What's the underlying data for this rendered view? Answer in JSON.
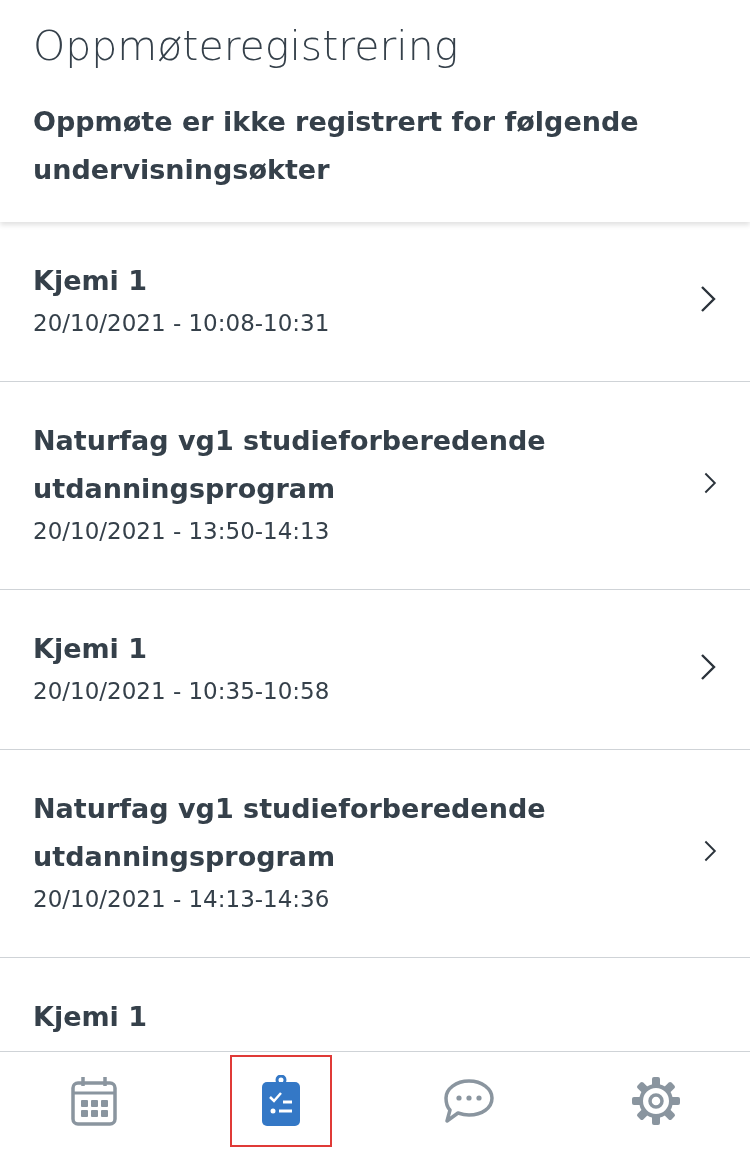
{
  "header": {
    "title": "Oppmøteregistrering",
    "subtitle": "Oppmøte er ikke registrert for følgende undervisningsøkter"
  },
  "sessions": [
    {
      "title": "Kjemi 1",
      "time": "20/10/2021 - 10:08-10:31"
    },
    {
      "title": "Naturfag vg1 studieforberedende utdanningsprogram",
      "time": "20/10/2021 - 13:50-14:13"
    },
    {
      "title": "Kjemi 1",
      "time": "20/10/2021 - 10:35-10:58"
    },
    {
      "title": "Naturfag vg1 studieforberedende utdanningsprogram",
      "time": "20/10/2021 - 14:13-14:36"
    },
    {
      "title": "Kjemi 1"
    }
  ],
  "tabs": [
    {
      "kind": "calendar",
      "selected": false
    },
    {
      "kind": "attendance",
      "selected": true
    },
    {
      "kind": "messages",
      "selected": false
    },
    {
      "kind": "settings",
      "selected": false
    }
  ]
}
